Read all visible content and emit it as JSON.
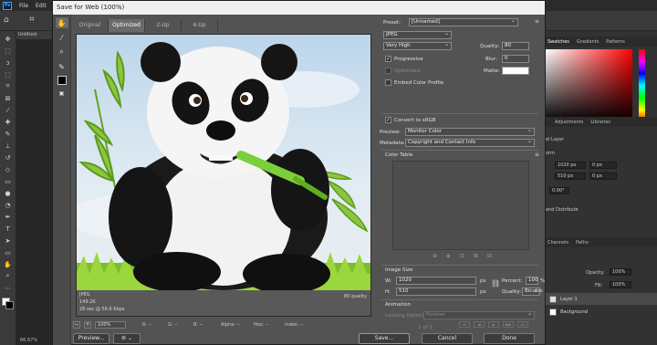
{
  "photoshop": {
    "logo": "Ps",
    "menu": [
      "File",
      "Edit"
    ],
    "doc_tab": "Untitled-",
    "status": "66.67%",
    "right_panel": {
      "top_tabs": [
        "Swatches",
        "Gradients",
        "Patterns"
      ],
      "properties_tabs": [
        "Adjustments",
        "Libraries"
      ],
      "layer_heading": "el Layer",
      "transform_heading": "orm",
      "w_value": "1020 px",
      "h_value": "510 px",
      "x_value": "0 px",
      "y_value": "0 px",
      "angle_value": "0.00°",
      "align_heading": "and Distribute",
      "layer_tabs": [
        "Channels",
        "Paths"
      ],
      "opacity_label": "Opacity:",
      "opacity_value": "100%",
      "fill_label": "Fill:",
      "fill_value": "100%",
      "layers": [
        {
          "name": "Layer 1",
          "selected": true
        },
        {
          "name": "Background",
          "selected": false
        }
      ]
    }
  },
  "dialog": {
    "title": "Save for Web (100%)",
    "view_tabs": [
      "Original",
      "Optimized",
      "2-Up",
      "4-Up"
    ],
    "active_view_tab": "Optimized",
    "preview_info": {
      "format": "JPEG",
      "size": "149.2K",
      "time": "28 sec @ 56.6 Kbps",
      "quality": "80 quality"
    },
    "zoom": {
      "minus": "−",
      "plus": "+",
      "value": "100%"
    },
    "readouts": {
      "r": "R: --",
      "g": "G: --",
      "b": "B: --",
      "alpha": "Alpha: --",
      "hex": "Hex: --",
      "index": "Index: --"
    },
    "buttons": {
      "preview": "Preview...",
      "save": "Save...",
      "cancel": "Cancel",
      "done": "Done"
    },
    "settings": {
      "preset_label": "Preset:",
      "preset_value": "[Unnamed]",
      "format_value": "JPEG",
      "compression_value": "Very High",
      "quality_label": "Quality:",
      "quality_value": "80",
      "blur_label": "Blur:",
      "blur_value": "0",
      "matte_label": "Matte:",
      "progressive_label": "Progressive",
      "optimized_label": "Optimized",
      "embed_profile_label": "Embed Color Profile",
      "convert_srgb_label": "Convert to sRGB",
      "preview_label": "Preview:",
      "preview_value": "Monitor Color",
      "metadata_label": "Metadata:",
      "metadata_value": "Copyright and Contact Info",
      "color_table_label": "Color Table",
      "image_size_label": "Image Size",
      "w_label": "W:",
      "w_value": "1020",
      "h_label": "H:",
      "h_value": "510",
      "px_unit": "px",
      "percent_label": "Percent:",
      "percent_value": "100",
      "percent_unit": "%",
      "resample_label": "Quality:",
      "resample_value": "Bicubic",
      "animation_label": "Animation",
      "looping_label": "Looping Options:",
      "looping_value": "Forever",
      "frame_counter": "1 of 1"
    },
    "colors": {
      "dialog_bg": "#535353",
      "title_bg": "#f0f0f0",
      "matte_swatch": "#ffffff"
    }
  }
}
